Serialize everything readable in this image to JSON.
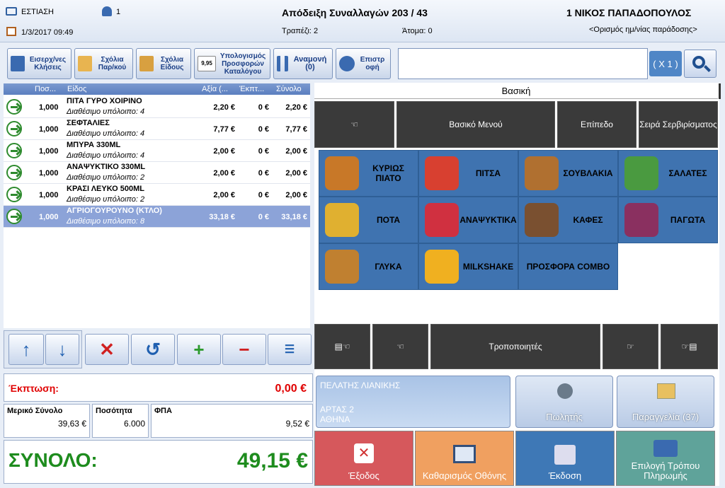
{
  "header": {
    "station": "ΕΣΤΙΑΣΗ",
    "users": "1",
    "datetime": "1/3/2017 09:49",
    "title": "Απόδειξη Συναλλαγών  203 / 43",
    "table": "Τραπέζι: 2",
    "persons": "Άτομα: 0",
    "cashier": "1 ΝΙΚΟΣ ΠΑΠΑΔΟΠΟΥΛΟΣ",
    "delivery": "<Ορισμός ημ/νίας παράδοσης>"
  },
  "toolbar": [
    {
      "label": "Εισερχ/νες Κλήσεις"
    },
    {
      "label": "Σχόλια Παρ/κού"
    },
    {
      "label": "Σχόλια Είδους"
    },
    {
      "label": "Υπολογισμός Προσφορών Καταλόγου",
      "icon_text": "9,95"
    },
    {
      "label": "Αναμονή (0)"
    },
    {
      "label": "Επιστρ οφή"
    }
  ],
  "search": {
    "multiplier": "( X 1 )",
    "value": ""
  },
  "grid": {
    "cols": [
      "Ποσ...",
      "Είδος",
      "Αξία (...",
      "Έκπτ...",
      "Σύνολο"
    ],
    "rows": [
      {
        "qty": "1,000",
        "name": "ΠΙΤΑ ΓΥΡΟ ΧΟΙΡΙΝΟ",
        "stock": "Διαθέσιμο υπόλοιπο: 4",
        "value": "2,20 €",
        "disc": "0 €",
        "total": "2,20 €"
      },
      {
        "qty": "1,000",
        "name": "ΣΕΦΤΑΛΙΕΣ",
        "stock": "Διαθέσιμο υπόλοιπο: 4",
        "value": "7,77 €",
        "disc": "0 €",
        "total": "7,77 €"
      },
      {
        "qty": "1,000",
        "name": "ΜΠΥΡΑ 330ML",
        "stock": "Διαθέσιμο υπόλοιπο: 4",
        "value": "2,00 €",
        "disc": "0 €",
        "total": "2,00 €"
      },
      {
        "qty": "1,000",
        "name": "ΑΝΑΨΥΚΤΙΚΟ  330ML",
        "stock": "Διαθέσιμο υπόλοιπο: 2",
        "value": "2,00 €",
        "disc": "0 €",
        "total": "2,00 €"
      },
      {
        "qty": "1,000",
        "name": "ΚΡΑΣΙ ΛΕΥΚΟ  500ML",
        "stock": "Διαθέσιμο υπόλοιπο: 2",
        "value": "2,00 €",
        "disc": "0 €",
        "total": "2,00 €"
      },
      {
        "qty": "1,000",
        "name": "ΑΓΡΙΟΓΟΥΡΟΥΝΟ (ΚΤΛΟ)",
        "stock": "Διαθέσιμο υπόλοιπο:  8",
        "value": "33,18 €",
        "disc": "0 €",
        "total": "33,18 €"
      }
    ]
  },
  "summary": {
    "discount_label": "Έκπτωση:",
    "discount": "0,00 €",
    "subtotal_label": "Μερικό Σύνολο",
    "subtotal": "39,63 €",
    "qty_label": "Ποσότητα",
    "qty": "6.000",
    "vat_label": "ΦΠΑ",
    "vat": "9,52 €",
    "total_label": "ΣΥΝΟΛΟ:",
    "total": "49,15 €"
  },
  "menu": {
    "tab": "Βασική",
    "top": [
      "Βασικό Μενού",
      "Επίπεδο",
      "Σειρά Σερβιρίσματος"
    ],
    "top_icon": "☜",
    "cats": [
      "ΚΥΡΙΩΣ ΠΙΑΤΟ",
      "ΠΙΤΣΑ",
      "ΣΟΥΒΛΑΚΙΑ",
      "ΣΑΛΑΤΕΣ",
      "ΠΟΤΑ",
      "ΑΝΑΨΥΚΤΙΚΑ",
      "ΚΑΦΕΣ",
      "ΠΑΓΩΤΑ",
      "ΓΛΥΚΑ",
      "MILKSHAKE",
      "ΠΡΟΣΦΟΡΑ COMBO"
    ],
    "modifiers": "Τροποποιητές",
    "icons": [
      "▤☜",
      "☜",
      "☞",
      "☞▤"
    ]
  },
  "customer": {
    "name": "ΠΕΛΑΤΗΣ ΛΙΑΝΙΚΗΣ",
    "address": "ΑΡΤΑΣ 2",
    "city": "ΑΘΗΝΑ"
  },
  "actions": {
    "seller": "Πωλητής",
    "orders": "Παραγγελία (37)",
    "exit": "Έξοδος",
    "clear": "Καθαρισμός Οθόνης",
    "issue": "Έκδοση",
    "pay": "Επιλογή Τρόπου Πληρωμής"
  },
  "colors": {
    "accent": "#3f73b0",
    "discount": "#e00000",
    "total": "#1e8c1e",
    "exit": "#d6585c",
    "clear": "#f0a060",
    "issue": "#3e78b6",
    "pay": "#5fa39a"
  }
}
